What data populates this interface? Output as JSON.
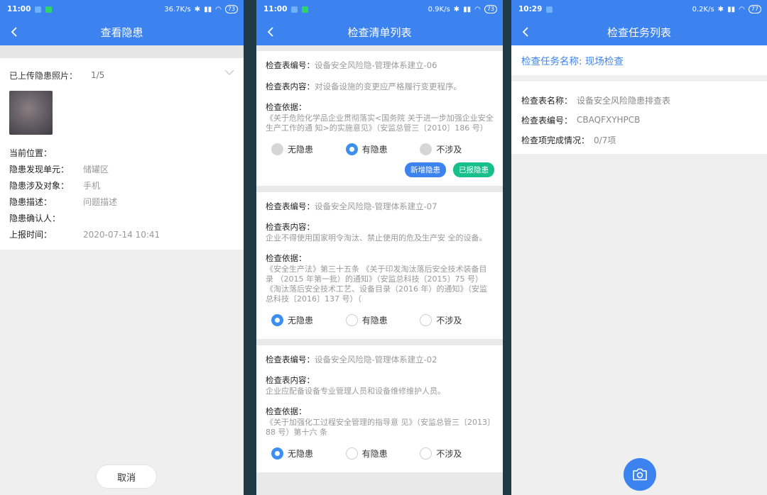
{
  "colors": {
    "brand": "#3d83ef",
    "green": "#17c08b"
  },
  "screen1": {
    "status": {
      "time": "11:00",
      "speed": "36.7K/s",
      "battery": "73"
    },
    "title": "查看隐患",
    "upload_label": "已上传隐患照片：",
    "upload_count": "1/5",
    "fields": [
      {
        "label": "当前位置：",
        "value": ""
      },
      {
        "label": "隐患发现单元：",
        "value": "储罐区"
      },
      {
        "label": "隐患涉及对象：",
        "value": "手机"
      },
      {
        "label": "隐患描述：",
        "value": "问题描述"
      },
      {
        "label": "隐患确认人：",
        "value": ""
      },
      {
        "label": "上报时间：",
        "value": "2020-07-14 10:41"
      }
    ],
    "cancel_button": "取消"
  },
  "screen2": {
    "status": {
      "time": "11:00",
      "speed": "0.9K/s",
      "battery": "73"
    },
    "title": "检查清单列表",
    "labels": {
      "code": "检查表编号：",
      "content": "检查表内容：",
      "basis": "检查依据："
    },
    "options": [
      "无隐患",
      "有隐患",
      "不涉及"
    ],
    "cards": [
      {
        "code": "设备安全风险隐-管理体系建立-06",
        "content": "对设备设施的变更应严格履行变更程序。",
        "basis": "《关于危险化学品企业贯彻落实<国务院 关于进一步加强企业安全生产工作的通 知>的实施意见》（安监总管三〔2010〕186 号）",
        "selected": "有隐患",
        "buttons": {
          "add": "新增隐患",
          "reported": "已报隐患"
        }
      },
      {
        "code": "设备安全风险隐-管理体系建立-07",
        "content": "企业不得使用国家明令淘汰、禁止使用的危及生产安 全的设备。",
        "basis": "《安全生产法》第三十五条 《关于印发淘汰落后安全技术装备目录 （2015 年第一批）的通知》（安监总科技〔2015〕75 号）《淘汰落后安全技术工艺、设备目录（2016 年）的通知》（安监总科技〔2016〕137 号）（",
        "selected": "无隐患"
      },
      {
        "code": "设备安全风险隐-管理体系建立-02",
        "content": "企业应配备设备专业管理人员和设备维修维护人员。",
        "basis": "《关于加强化工过程安全管理的指导意 见》（安监总管三〔2013〕88 号）第十六 条",
        "selected": "无隐患"
      }
    ]
  },
  "screen3": {
    "status": {
      "time": "10:29",
      "speed": "0.2K/s",
      "battery": "77"
    },
    "title": "检查任务列表",
    "task_name": "检查任务名称: 现场检查",
    "fields": [
      {
        "label": "检查表名称：",
        "value": "设备安全风险隐患排查表"
      },
      {
        "label": "检查表编号：",
        "value": "CBAQFXYHPCB"
      },
      {
        "label": "检查项完成情况：",
        "value": "0/7项"
      }
    ],
    "fab_icon": "camera-icon"
  }
}
